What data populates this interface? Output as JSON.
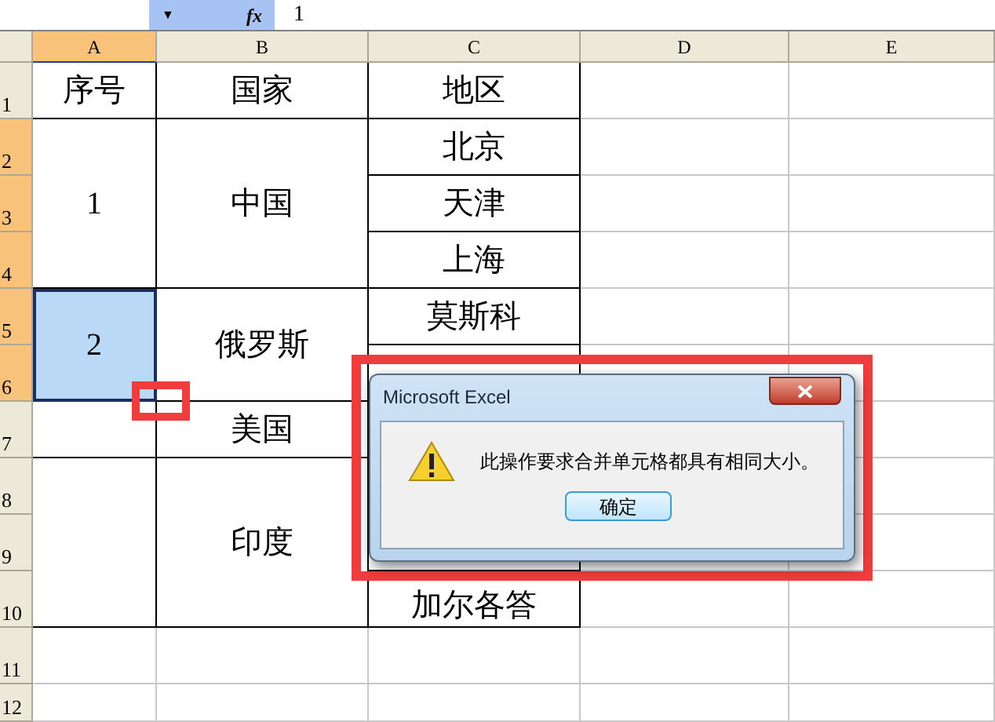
{
  "formula_bar": {
    "dropdown": "▼",
    "fx": "fx",
    "value": "1"
  },
  "column_headers": [
    {
      "label": "A",
      "selected": true
    },
    {
      "label": "B",
      "selected": false
    },
    {
      "label": "C",
      "selected": false
    },
    {
      "label": "D",
      "selected": false
    },
    {
      "label": "E",
      "selected": false
    }
  ],
  "row_headers": [
    {
      "label": "1",
      "selected": false
    },
    {
      "label": "2",
      "selected": true
    },
    {
      "label": "3",
      "selected": true
    },
    {
      "label": "4",
      "selected": true
    },
    {
      "label": "5",
      "selected": true
    },
    {
      "label": "6",
      "selected": true
    },
    {
      "label": "7",
      "selected": false
    },
    {
      "label": "8",
      "selected": false
    },
    {
      "label": "9",
      "selected": false
    },
    {
      "label": "10",
      "selected": false
    },
    {
      "label": "11",
      "selected": false
    },
    {
      "label": "12",
      "selected": false
    }
  ],
  "table": [
    [
      {
        "text": "序号",
        "kind": "single",
        "selected": false
      },
      {
        "text": "1",
        "kind": "triple",
        "selected": false
      },
      {
        "text": "2",
        "kind": "double",
        "selected": true
      },
      {
        "kind": "single",
        "selected": false
      },
      {
        "kind": "triple",
        "selected": false
      }
    ],
    [
      {
        "text": "国家",
        "kind": "single",
        "selected": false
      },
      {
        "text": "中国",
        "kind": "triple",
        "selected": false
      },
      {
        "text": "俄罗斯",
        "kind": "double",
        "selected": false
      },
      {
        "text": "美国",
        "kind": "single",
        "selected": false
      },
      {
        "text": "印度",
        "kind": "triple",
        "selected": false
      }
    ],
    [
      {
        "text": "地区",
        "kind": "single",
        "selected": false
      },
      {
        "text": "北京",
        "kind": "single",
        "selected": false
      },
      {
        "text": "天津",
        "kind": "single",
        "selected": false
      },
      {
        "text": "上海",
        "kind": "single",
        "selected": false
      },
      {
        "text": "莫斯科",
        "kind": "single",
        "selected": false
      },
      {
        "kind": "single"
      },
      {
        "kind": "covered"
      },
      {
        "kind": "covered"
      },
      {
        "kind": "single"
      },
      {
        "text": "加尔各答",
        "kind": "single",
        "selected": false
      }
    ]
  ],
  "dialog": {
    "title": "Microsoft Excel",
    "message": "此操作要求合并单元格都具有相同大小。",
    "button": "确定"
  }
}
